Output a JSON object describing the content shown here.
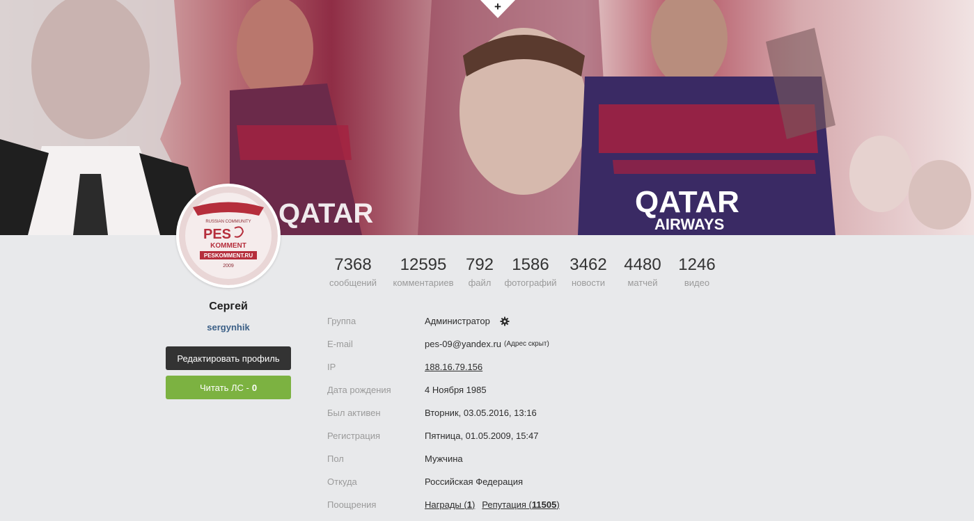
{
  "profile": {
    "name": "Сергей",
    "login": "sergynhik",
    "edit_button": "Редактировать профиль",
    "pm_button": "Читать ЛС - ",
    "pm_count": "0"
  },
  "avatar_logo": {
    "top": "RUSSIAN COMMUNITY",
    "main": "PES",
    "sub": "KOMMENT",
    "site": "PESKOMMENT.RU",
    "year": "2009"
  },
  "banner": {
    "add_cover_glyph": "+",
    "sponsor_text": "QATAR",
    "sponsor_sub": "AIRWAYS"
  },
  "stats": [
    {
      "num": "7368",
      "label": "сообщений"
    },
    {
      "num": "12595",
      "label": "комментариев"
    },
    {
      "num": "792",
      "label": "файл"
    },
    {
      "num": "1586",
      "label": "фотографий"
    },
    {
      "num": "3462",
      "label": "новости"
    },
    {
      "num": "4480",
      "label": "матчей"
    },
    {
      "num": "1246",
      "label": "видео"
    }
  ],
  "info": {
    "group": {
      "k": "Группа",
      "v": "Администратор"
    },
    "email": {
      "k": "E-mail",
      "v": "pes-09@yandex.ru",
      "note": "(Адрес скрыт)"
    },
    "ip": {
      "k": "IP",
      "v": "188.16.79.156"
    },
    "birth": {
      "k": "Дата рождения",
      "v": "4 Ноября 1985"
    },
    "active": {
      "k": "Был активен",
      "v": "Вторник, 03.05.2016, 13:16"
    },
    "reg": {
      "k": "Регистрация",
      "v": "Пятница, 01.05.2009, 15:47"
    },
    "sex": {
      "k": "Пол",
      "v": "Мужчина"
    },
    "from": {
      "k": "Откуда",
      "v": "Российская Федерация"
    },
    "rewards": {
      "k": "Поощрения",
      "awards_label": "Награды (",
      "awards_count": "1",
      "rep_label": "Репутация (",
      "rep_count": "11505",
      "close": ")"
    }
  },
  "colors": {
    "edit_btn": "#333333",
    "pm_btn": "#7cb241",
    "login": "#3b5f86",
    "page_bg": "#e8e9eb"
  }
}
